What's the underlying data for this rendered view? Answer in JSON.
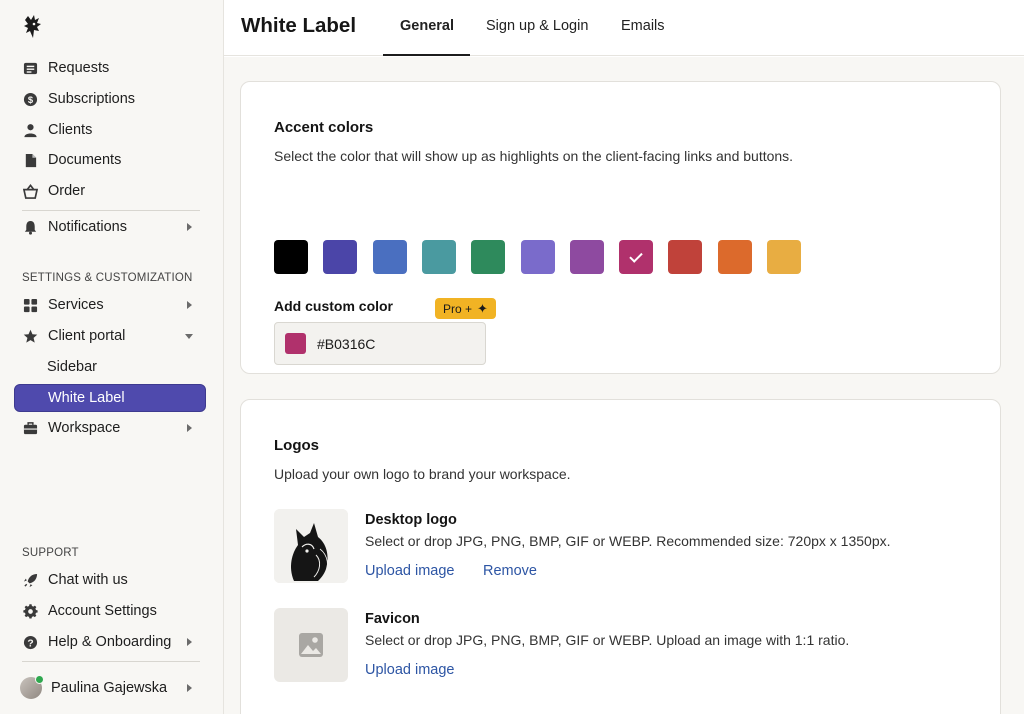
{
  "sidebar": {
    "brand_icon": "wolf-logo-icon",
    "main_items": [
      {
        "label": "Requests",
        "icon": "list-icon"
      },
      {
        "label": "Subscriptions",
        "icon": "dollar-circle-icon"
      },
      {
        "label": "Clients",
        "icon": "person-icon"
      },
      {
        "label": "Documents",
        "icon": "document-icon"
      },
      {
        "label": "Order",
        "icon": "basket-icon"
      }
    ],
    "notifications": {
      "label": "Notifications",
      "icon": "bell-icon"
    },
    "settings_section": "SETTINGS & CUSTOMIZATION",
    "settings_items": [
      {
        "label": "Services",
        "icon": "grid-icon"
      },
      {
        "label": "Client portal",
        "icon": "star-icon"
      },
      {
        "label": "Sidebar"
      },
      {
        "label": "White Label"
      },
      {
        "label": "Workspace",
        "icon": "briefcase-icon"
      }
    ],
    "support_section": "SUPPORT",
    "support_items": [
      {
        "label": "Chat with us",
        "icon": "rocket-icon"
      },
      {
        "label": "Account Settings",
        "icon": "gear-icon"
      },
      {
        "label": "Help & Onboarding",
        "icon": "help-circle-icon"
      }
    ],
    "user": {
      "name": "Paulina Gajewska",
      "status_color": "#2fa84f"
    }
  },
  "header": {
    "title": "White Label",
    "tabs": [
      "General",
      "Sign up & Login",
      "Emails"
    ],
    "active_tab": "General"
  },
  "accent": {
    "title": "Accent colors",
    "description": "Select the color that will show up as highlights on the client-facing links and buttons.",
    "swatches": [
      "#000000",
      "#4b45a8",
      "#4a6fc0",
      "#4a9aa0",
      "#2e8a5c",
      "#7a6bcb",
      "#8e4aa0",
      "#b0316c",
      "#c0423a",
      "#dc6a2c",
      "#e8ad42"
    ],
    "selected": "#B0316C",
    "custom_label": "Add custom color",
    "pro_label": "Pro +",
    "custom_value": "#B0316C"
  },
  "logos": {
    "title": "Logos",
    "description": "Upload your own logo to brand your workspace.",
    "desktop": {
      "name": "Desktop logo",
      "help": "Select or drop JPG, PNG, BMP, GIF or WEBP. Recommended size: 720px x 1350px.",
      "upload_label": "Upload image",
      "remove_label": "Remove"
    },
    "favicon": {
      "name": "Favicon",
      "help": "Select or drop JPG, PNG, BMP, GIF or WEBP. Upload an image with 1:1 ratio.",
      "upload_label": "Upload image"
    }
  }
}
